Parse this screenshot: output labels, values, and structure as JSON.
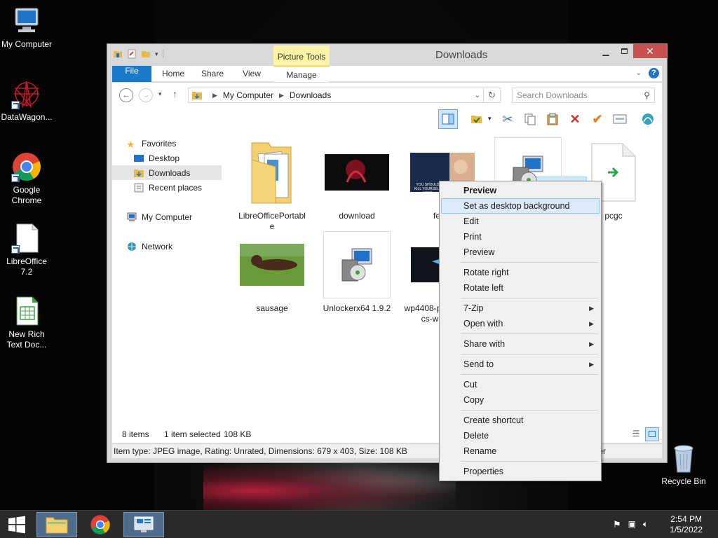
{
  "desktop": {
    "icons": [
      {
        "label": "My Computer"
      },
      {
        "label": "DataWagon..."
      },
      {
        "label": "Google Chrome"
      },
      {
        "label": "LibreOffice 7.2"
      },
      {
        "label": "New Rich Text Doc..."
      },
      {
        "label": "Recycle Bin"
      }
    ]
  },
  "window": {
    "title": "Downloads",
    "context_tab": "Picture Tools",
    "tabs": [
      "File",
      "Home",
      "Share",
      "View",
      "Manage"
    ],
    "address": {
      "root": "My Computer",
      "current": "Downloads"
    },
    "search_placeholder": "Search Downloads",
    "nav": {
      "favorites": "Favorites",
      "desktop": "Desktop",
      "downloads": "Downloads",
      "recent": "Recent places",
      "computer": "My Computer",
      "network": "Network"
    },
    "files": [
      {
        "name": "LibreOfficePortable"
      },
      {
        "name": "download"
      },
      {
        "name": "fetch"
      },
      {
        "name": ""
      },
      {
        "name": "pcgc"
      },
      {
        "name": "sausage"
      },
      {
        "name": "Unlockerx64 1.9.2"
      },
      {
        "name": "wp4408-pics-wa"
      }
    ],
    "thumb_text": "YOU SHOULD KILL YOURSELF NOW!",
    "status": {
      "items": "8 items",
      "selected": "1 item selected",
      "size": "108 KB"
    },
    "details": "Item type: JPEG image, Rating: Unrated, Dimensions: 679 x 403, Size: 108 KB",
    "details_tail": "ter"
  },
  "context_menu": {
    "items": {
      "preview_bold": "Preview",
      "set_bg": "Set as desktop background",
      "edit": "Edit",
      "print": "Print",
      "preview": "Preview",
      "rotate_right": "Rotate right",
      "rotate_left": "Rotate left",
      "zip": "7-Zip",
      "open_with": "Open with",
      "share_with": "Share with",
      "send_to": "Send to",
      "cut": "Cut",
      "copy": "Copy",
      "create_shortcut": "Create shortcut",
      "delete": "Delete",
      "rename": "Rename",
      "properties": "Properties"
    }
  },
  "taskbar": {
    "time": "2:54 PM",
    "date": "1/5/2022"
  },
  "colors": {
    "accent": "#1979ca",
    "selection": "#cce8ff",
    "close": "#c75050"
  }
}
